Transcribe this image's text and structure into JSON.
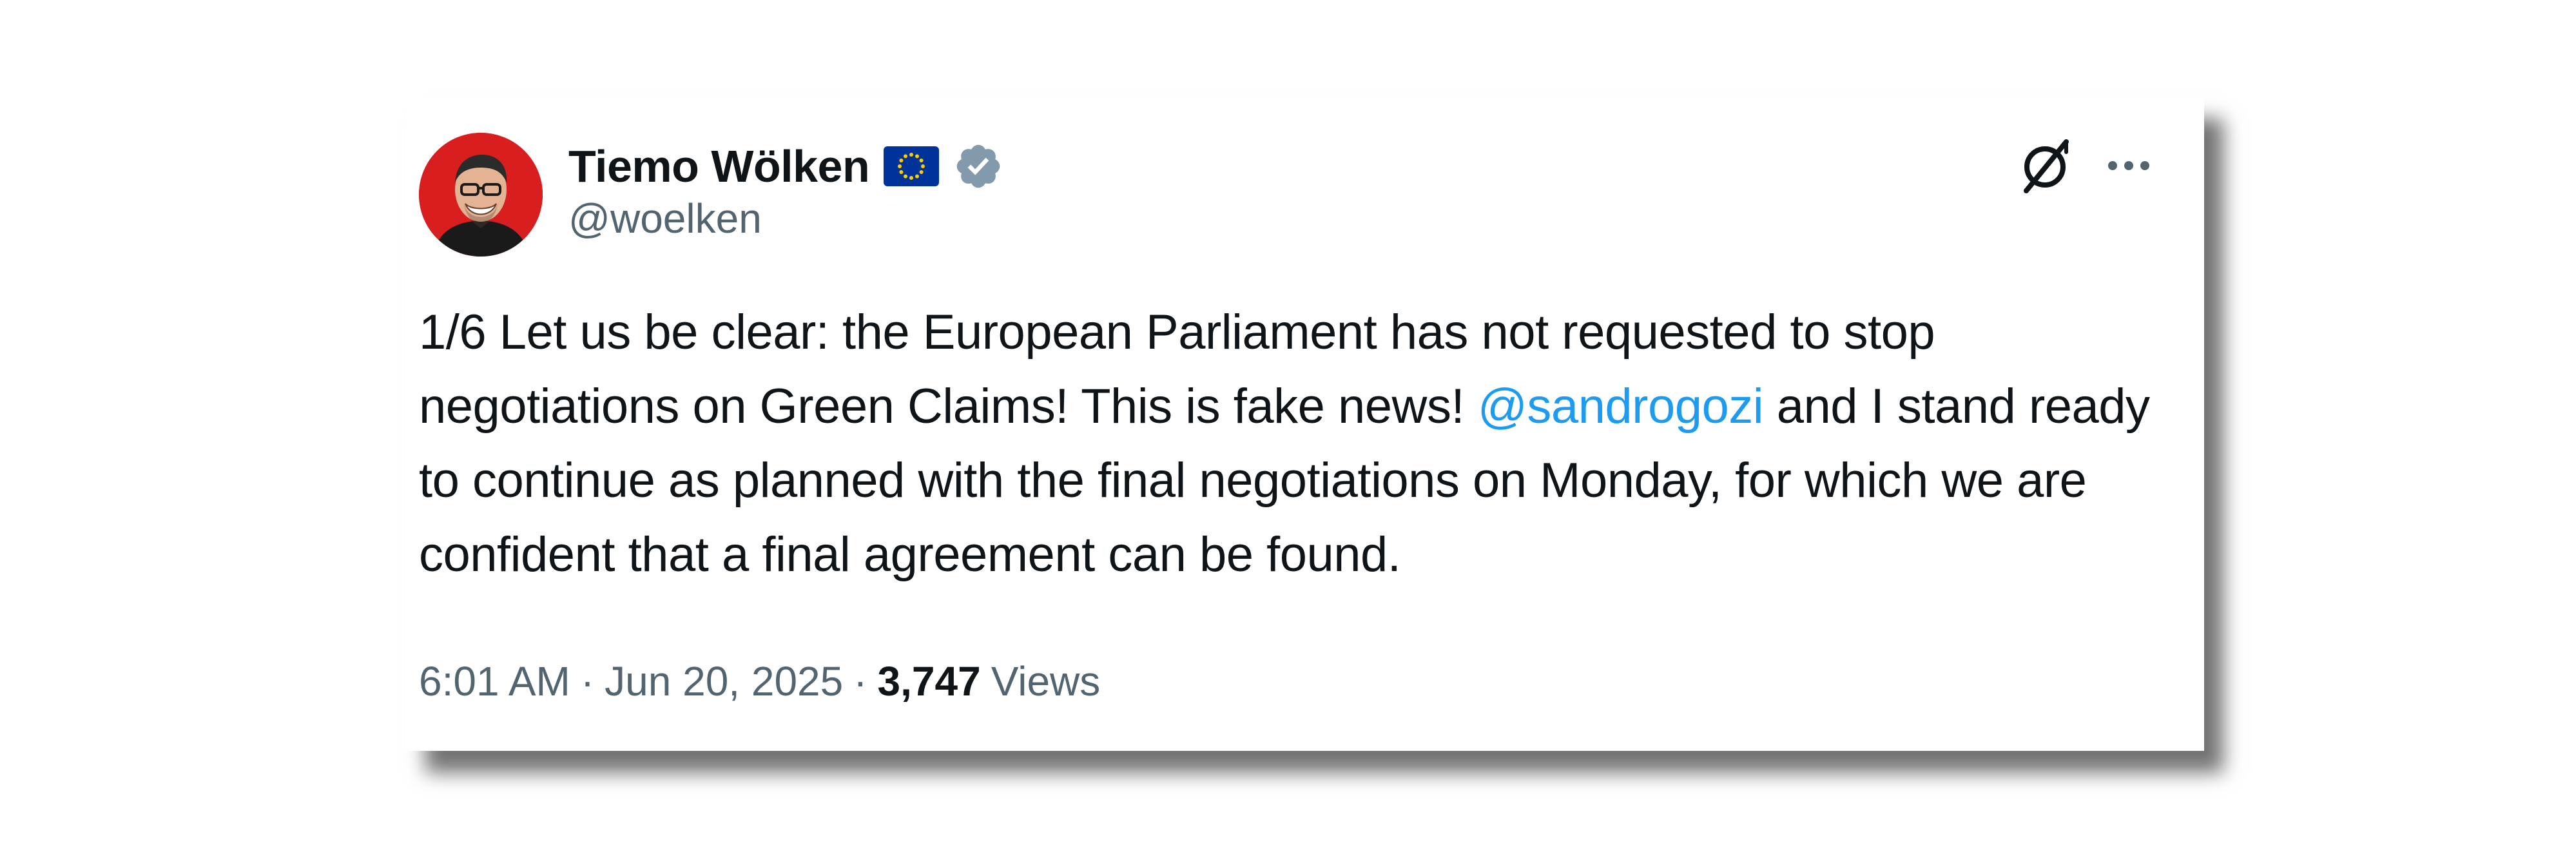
{
  "tweet": {
    "author": {
      "name": "Tiemo Wölken",
      "handle": "@woelken",
      "avatar_icon": "profile-photo",
      "flag_icon": "eu-flag-icon",
      "verified_icon": "verified-badge-icon"
    },
    "header_icons": {
      "grok": "grok-icon",
      "more": "more-options-icon"
    },
    "text": {
      "part1": "1/6 Let us be clear: the European Parliament has not requested to stop negotiations on Green Claims! This is fake news! ",
      "mention": "@sandrogozi",
      "part2": " and I stand ready to continue as planned with the final negotiations on Monday, for which we are confident that a final agreement can be found."
    },
    "meta": {
      "time": "6:01 AM",
      "separator": "·",
      "date": "Jun 20, 2025",
      "views_count": "3,747",
      "views_label": "Views"
    },
    "colors": {
      "text": "#0f1419",
      "secondary": "#536471",
      "mention": "#1d9bf0",
      "verified": "#829aab",
      "eu_blue": "#003399",
      "eu_gold": "#ffcc00"
    }
  }
}
